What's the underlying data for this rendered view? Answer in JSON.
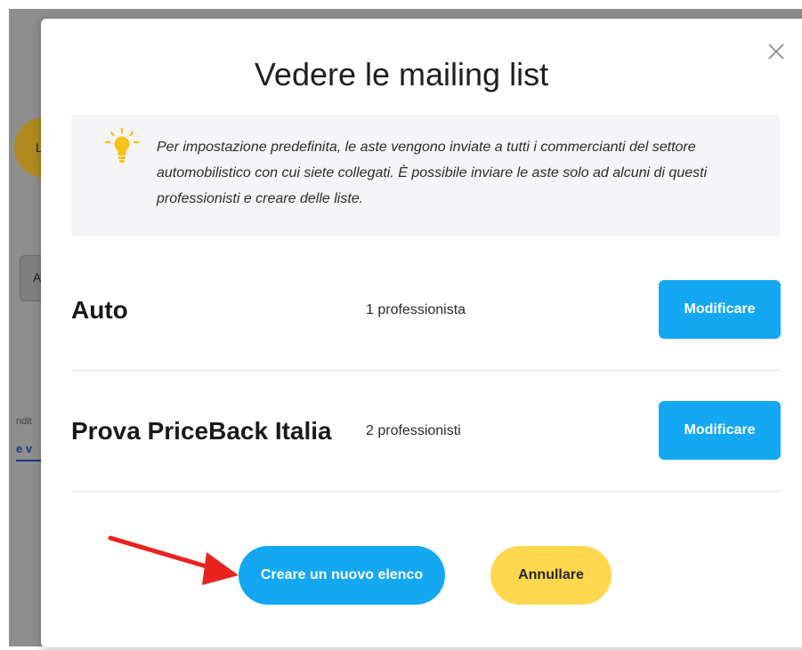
{
  "background": {
    "avatar_letter": "L",
    "box_letter": "A",
    "snippet_text": "ndit",
    "snippet_link": "e v"
  },
  "modal": {
    "title": "Vedere le mailing list",
    "close_icon": "close-icon",
    "info": {
      "icon": "lightbulb-icon",
      "text": "Per impostazione predefinita, le aste vengono inviate a tutti i commercianti del settore automobilistico con cui siete collegati. È possibile inviare le aste solo ad alcuni di questi professionisti e creare delle liste."
    },
    "lists": [
      {
        "name": "Auto",
        "count": "1 professionista",
        "button": "Modificare"
      },
      {
        "name": "Prova PriceBack Italia",
        "count": "2 professionisti",
        "button": "Modificare"
      }
    ],
    "create_button": "Creare un nuovo elenco",
    "cancel_button": "Annullare"
  },
  "colors": {
    "primary": "#14a8f2",
    "secondary": "#ffd84f",
    "annotation_arrow": "#e8231d"
  }
}
